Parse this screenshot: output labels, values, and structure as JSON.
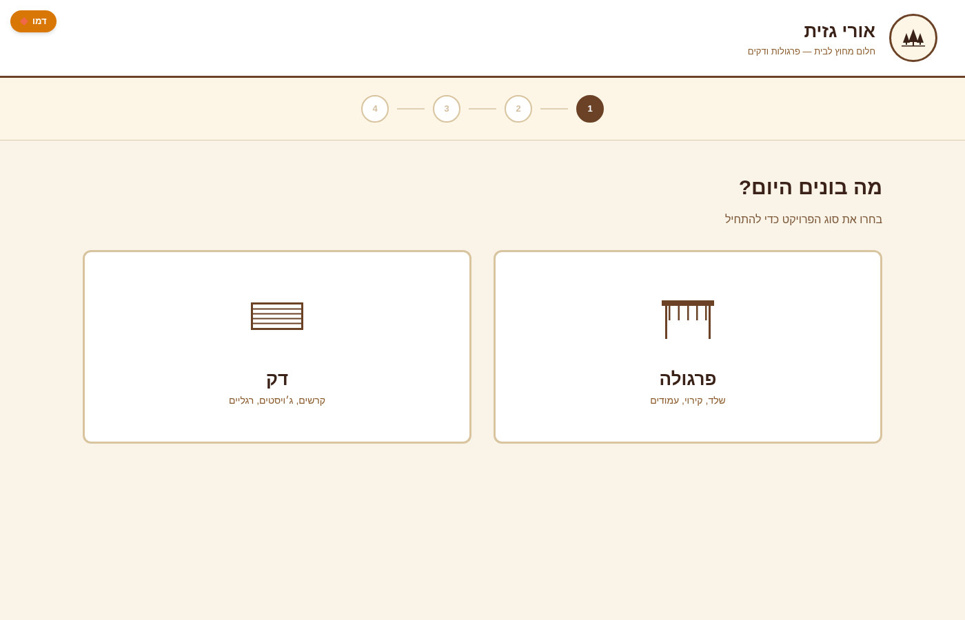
{
  "demo_badge": {
    "label": "דמו"
  },
  "header": {
    "title": "אורי גזית",
    "tagline": "חלום מחוץ לבית — פרגולות ודקים"
  },
  "steps": [
    {
      "label": "1",
      "selected": true
    },
    {
      "label": "2",
      "selected": false
    },
    {
      "label": "3",
      "selected": false
    },
    {
      "label": "4",
      "selected": false
    }
  ],
  "page": {
    "heading": "מה בונים היום?",
    "subheading": "בחרו את סוג הפרויקט כדי להתחיל"
  },
  "project_types": [
    {
      "kind": "pergola",
      "title": "פרגולה",
      "description": "שלד, קירוי, עמודים"
    },
    {
      "kind": "deck",
      "title": "דק",
      "description": "קרשים, ג׳ויסטים, רגליים"
    }
  ]
}
